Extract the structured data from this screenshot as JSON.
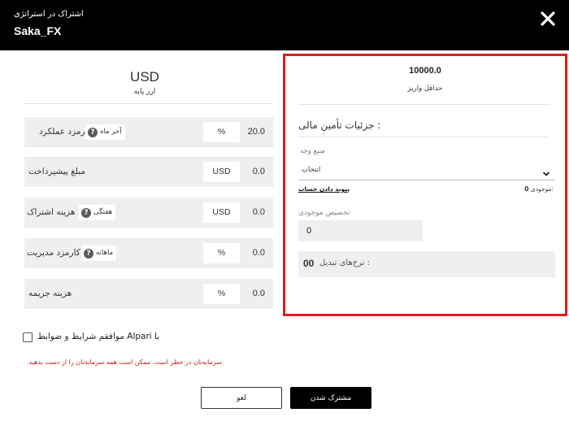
{
  "header": {
    "subtitle": "اشتراک در استراتژی",
    "title": "Saka_FX",
    "close_icon": "close-icon"
  },
  "base_currency": {
    "code": "USD",
    "label": "ارز پایه"
  },
  "fees": [
    {
      "label": "کارمزد عملکرد",
      "badge": "آخر ماه",
      "has_help": true,
      "unit": "%",
      "value": "20.0"
    },
    {
      "label": "مبلغ پیشپرداخت",
      "badge": "",
      "has_help": false,
      "unit": "USD",
      "value": "0.0"
    },
    {
      "label": "هزینه اشتراک",
      "badge": "هفتگی",
      "has_help": true,
      "unit": "USD",
      "value": "0.0"
    },
    {
      "label": "کارمزد مدیریت",
      "badge": "ماهانه",
      "has_help": true,
      "unit": "%",
      "value": "0.0"
    },
    {
      "label": "هزینه جریمه",
      "badge": "",
      "has_help": false,
      "unit": "%",
      "value": "0.0"
    }
  ],
  "help_glyph": "?",
  "funding": {
    "min_deposit": "10000.0",
    "min_deposit_label": "حداقل واریز",
    "title": "جزئیات تأمین مالی :",
    "source_label": "منبع وجه",
    "source_selected": "انتخاب",
    "link_account": "پیوند دادن حساب",
    "balance_label": "موجودی:",
    "balance_value": "0",
    "allocation_label": "تخصیص موجودی",
    "allocation_value": "0",
    "rate_label": "نرخ‌های تبدیل :",
    "rate_value": "00"
  },
  "terms": {
    "text": "موافقم شرایط و ضوابط Alpari با"
  },
  "risk_warning": ".سرمایه‌تان در خطر است. ممکن است همه سرمایه‌تان را از دست بدهید",
  "buttons": {
    "cancel": "لغو",
    "subscribe": "مشترک شدن"
  }
}
